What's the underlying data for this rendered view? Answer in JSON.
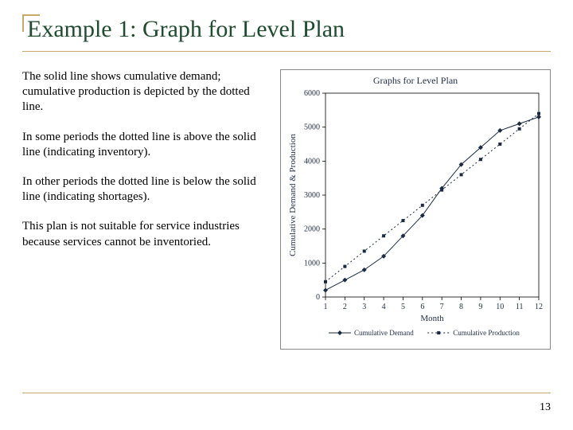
{
  "title": "Example 1: Graph for Level Plan",
  "paragraphs": [
    "The solid line shows cumulative demand; cumulative production is depicted by the dotted line.",
    "In some periods the dotted line is above the solid line (indicating inventory).",
    "In other periods the dotted line is below the solid line (indicating shortages).",
    "This plan is not suitable for service industries because services cannot be inventoried."
  ],
  "page_number": "13",
  "chart_data": {
    "type": "line",
    "title": "Graphs for Level Plan",
    "xlabel": "Month",
    "ylabel": "Cumulative Demand & Production",
    "x": [
      1,
      2,
      3,
      4,
      5,
      6,
      7,
      8,
      9,
      10,
      11,
      12
    ],
    "y_ticks": [
      0,
      1000,
      2000,
      3000,
      4000,
      5000,
      6000
    ],
    "xlim": [
      1,
      12
    ],
    "ylim": [
      0,
      6000
    ],
    "grid": false,
    "legend_position": "bottom",
    "series": [
      {
        "name": "Cumulative Demand",
        "style": "solid",
        "values": [
          200,
          500,
          800,
          1200,
          1800,
          2400,
          3200,
          3900,
          4400,
          4900,
          5100,
          5300
        ]
      },
      {
        "name": "Cumulative Production",
        "style": "dotted",
        "values": [
          450,
          900,
          1350,
          1800,
          2250,
          2700,
          3150,
          3600,
          4050,
          4500,
          4950,
          5400
        ]
      }
    ]
  }
}
